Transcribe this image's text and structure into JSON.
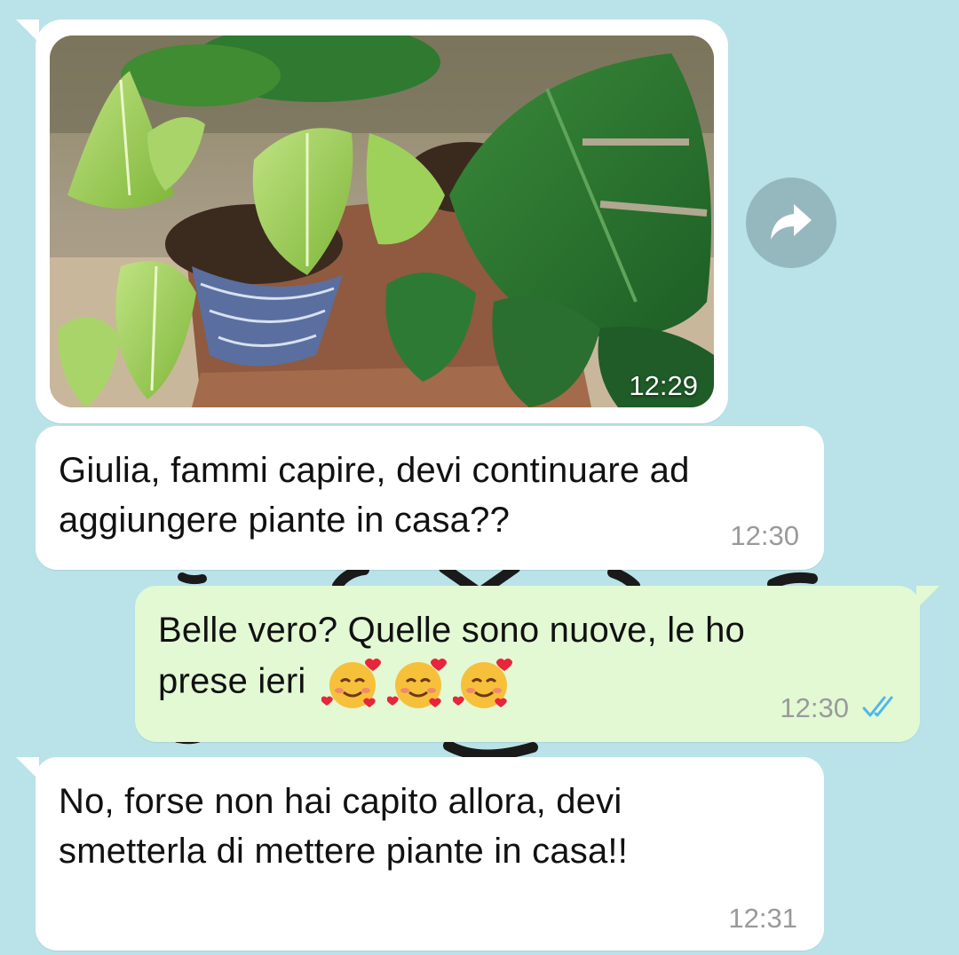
{
  "chat": {
    "messages": [
      {
        "type": "image",
        "direction": "incoming",
        "time": "12:29",
        "image_description": "plants-photo"
      },
      {
        "type": "text",
        "direction": "incoming",
        "text": "Giulia, fammi capire, devi continuare ad\naggiungere piante in casa??",
        "time": "12:30"
      },
      {
        "type": "text",
        "direction": "outgoing",
        "text_line1": "Belle vero? Quelle sono nuove, le ho",
        "text_line2": "prese ieri",
        "emojis": [
          "smiling-face-with-hearts",
          "smiling-face-with-hearts",
          "smiling-face-with-hearts"
        ],
        "time": "12:30",
        "status": "read"
      },
      {
        "type": "text",
        "direction": "incoming",
        "text": "No, forse non hai capito allora, devi\nsmetterla di mettere piante in casa!!",
        "time": "12:31"
      }
    ],
    "icons": {
      "forward": "forward-arrow-icon",
      "read_receipt": "double-check-icon"
    }
  },
  "colors": {
    "background": "#b9e3e8",
    "incoming_bubble": "#ffffff",
    "outgoing_bubble": "#e2f9d4",
    "read_check": "#4fb6ec",
    "timestamp": "#9a9a9a"
  }
}
